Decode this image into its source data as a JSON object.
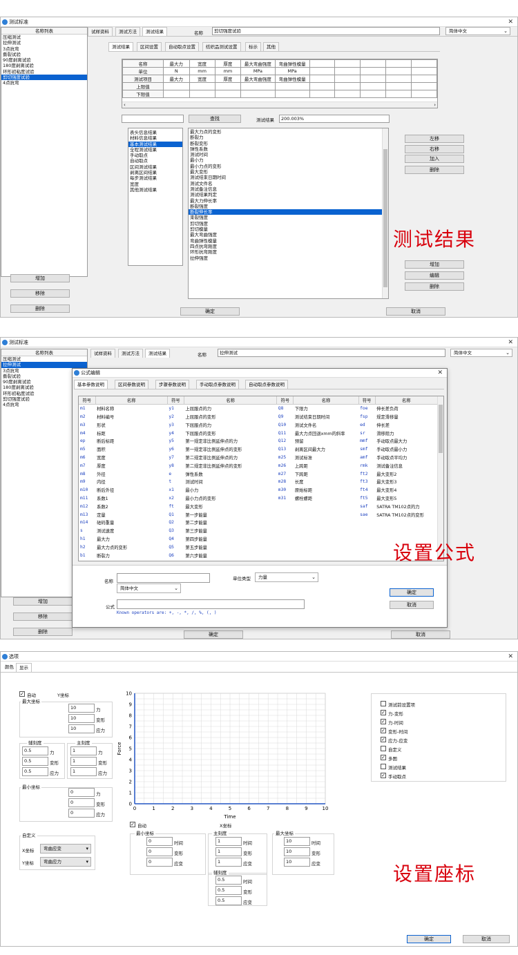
{
  "s1": {
    "title": "测试标准",
    "tabs": [
      "试样资料",
      "测试方法",
      "测试结果"
    ],
    "name_label": "名称",
    "name_value": "剪切强度试验",
    "lang": "简体中文",
    "std_header": "名称列表",
    "standards": [
      "压缩测试",
      "拉伸测试",
      "3点抗弯",
      "撕裂试验",
      "90度剥离试验",
      "180度剥离试验",
      "环形初粘度试验",
      "剪切强度试验",
      "4点抗弯"
    ],
    "std_selected": 7,
    "left_buttons": [
      "增加",
      "移除",
      "删除"
    ],
    "subtabs": [
      "测试结果",
      "区间设置",
      "自动取点设置",
      "纺织品测试设置",
      "标示",
      "其他"
    ],
    "grid_rows": [
      [
        "名称",
        "最大力",
        "宽度",
        "厚度",
        "最大弯曲强度",
        "弯曲弹性模量"
      ],
      [
        "单位",
        "N",
        "mm",
        "mm",
        "MPa",
        "MPa"
      ],
      [
        "测试项目",
        "最大力",
        "宽度",
        "厚度",
        "最大弯曲强度",
        "弯曲弹性模量"
      ],
      [
        "上限值",
        "",
        "",
        "",
        "",
        ""
      ],
      [
        "下限值",
        "",
        "",
        "",
        "",
        ""
      ]
    ],
    "search_btn": "查找",
    "result_label": "测试结果",
    "result_value": "200.003%",
    "categories": [
      "表头信息结果",
      "材料信息结果",
      "基本测试结果",
      "全程测试结果",
      "手动取点",
      "自动取点",
      "区间测试结果",
      "剥离区间结果",
      "每步测试结果",
      "宽度",
      "其他测试结果"
    ],
    "cat_selected": 2,
    "items": [
      "最大力点的变形",
      "断裂力",
      "断裂变形",
      "弹性系数",
      "测试时间",
      "最小力",
      "最小力点的变形",
      "最大变形",
      "测试结束日期时间",
      "测试文件名",
      "测试备注信息",
      "测试结果判定",
      "最大力伸长率",
      "断裂强度",
      "断裂伸长率",
      "束裂强度",
      "剪切强度",
      "剪切模量",
      "最大弯曲强度",
      "弯曲弹性模量",
      "四点抗弯刚度",
      "环形抗弯刚度",
      "拉伸强度"
    ],
    "item_selected": 14,
    "right_buttons_top": [
      "左移",
      "右移",
      "加入",
      "删除"
    ],
    "right_buttons_bot": [
      "增加",
      "编辑",
      "删除"
    ],
    "ok": "确定",
    "cancel": "取消",
    "caption": "测试结果"
  },
  "s2": {
    "title": "测试标准",
    "tabs": [
      "试样资料",
      "测试方法",
      "测试结果"
    ],
    "name_label": "名称",
    "name_value": "拉伸测试",
    "lang": "简体中文",
    "std_header": "名称列表",
    "standards": [
      "压缩测试",
      "拉伸测试",
      "3点抗弯",
      "撕裂试验",
      "90度剥离试验",
      "180度剥离试验",
      "环形初粘度试验",
      "剪切强度试验",
      "4点抗弯"
    ],
    "std_selected": 1,
    "left_buttons": [
      "增加",
      "移除",
      "删除"
    ],
    "ok": "确定",
    "cancel": "取消",
    "dialog": {
      "title": "公式编辑",
      "tabs": [
        "基本参数说明",
        "区间参数说明",
        "步骤参数说明",
        "手动取点参数说明",
        "自动取点参数说明"
      ],
      "headers": [
        "符号",
        "名称",
        "符号",
        "名称",
        "符号",
        "名称",
        "符号",
        "名称"
      ],
      "rows": [
        [
          "m1",
          "材料名称",
          "y1",
          "上屈服点的力",
          "Q8",
          "下限力",
          "foe",
          "伸长差负荷"
        ],
        [
          "m2",
          "材料编号",
          "y2",
          "上屈服点的变形",
          "Q9",
          "测试结束日期时间",
          "fsp",
          "规定滑移量"
        ],
        [
          "m3",
          "形状",
          "y3",
          "下屈服点的力",
          "Q10",
          "测试文件名",
          "ed",
          "伸长差"
        ],
        [
          "m4",
          "标距",
          "y4",
          "下屈服点的变形",
          "Q11",
          "最大力点回退xmm的斜率",
          "sr",
          "滑移阻力"
        ],
        [
          "ep",
          "断后标距",
          "y5",
          "第一规定非比例延伸点的力",
          "Q12",
          "预留",
          "mmf",
          "手动取点最大力"
        ],
        [
          "m5",
          "面积",
          "y6",
          "第一规定非比例延伸点的变形",
          "Q13",
          "剥离区间最大力",
          "smf",
          "手动取点最小力"
        ],
        [
          "m6",
          "宽度",
          "y7",
          "第二规定非比例延伸点的力",
          "m25",
          "测试标准",
          "amf",
          "手动取点平均力"
        ],
        [
          "m7",
          "厚度",
          "y8",
          "第二规定非比例延伸点的变形",
          "m26",
          "上跨距",
          "rmk",
          "测试备注信息"
        ],
        [
          "m8",
          "外径",
          "e",
          "弹性系数",
          "m27",
          "下跨距",
          "ft2",
          "最大变形2"
        ],
        [
          "m9",
          "内径",
          "t",
          "测试时间",
          "m28",
          "长度",
          "ft3",
          "最大变形3"
        ],
        [
          "m10",
          "断后外径",
          "x1",
          "最小力",
          "m30",
          "原始标距",
          "ft4",
          "最大变形4"
        ],
        [
          "m11",
          "系数1",
          "x2",
          "最小力点的变形",
          "m31",
          "螺栓螺距",
          "ft5",
          "最大变形5"
        ],
        [
          "m12",
          "系数2",
          "ft",
          "最大变形",
          "",
          "",
          "saf",
          "SATRA TM102点的力"
        ],
        [
          "m13",
          "定量",
          "Q1",
          "第一步能量",
          "",
          "",
          "sae",
          "SATRA TM102点的变形"
        ],
        [
          "m14",
          "砝码重量",
          "Q2",
          "第二步能量",
          "",
          "",
          "",
          ""
        ],
        [
          "s",
          "测试速度",
          "Q3",
          "第三步能量",
          "",
          "",
          "",
          ""
        ],
        [
          "h1",
          "最大力",
          "Q4",
          "第四步能量",
          "",
          "",
          "",
          ""
        ],
        [
          "h2",
          "最大力点的变形",
          "Q5",
          "第五步能量",
          "",
          "",
          "",
          ""
        ],
        [
          "b1",
          "断裂力",
          "Q6",
          "第六步能量",
          "",
          "",
          "",
          ""
        ]
      ],
      "name_label": "名称",
      "lang_value": "简体中文",
      "unit_label": "单位类型",
      "unit_value": "力量",
      "formula_label": "公式",
      "operators": "Known operators are: +, -, *, /, %, (, )",
      "ok": "确定",
      "cancel": "取消"
    },
    "caption": "设置公式"
  },
  "s3": {
    "title": "选项",
    "tabs": [
      "颜色",
      "显示"
    ],
    "auto_label": "自动",
    "y_axis_label": "Y坐标",
    "max_label": "最大坐标",
    "max_vals": [
      [
        "10",
        "力"
      ],
      [
        "10",
        "变形"
      ],
      [
        "10",
        "应力"
      ]
    ],
    "aux_label": "辅刻度",
    "aux_vals": [
      [
        "0.5",
        "力"
      ],
      [
        "0.5",
        "变形"
      ],
      [
        "0.5",
        "应力"
      ]
    ],
    "main_label": "主刻度",
    "main_vals": [
      [
        "1",
        "力"
      ],
      [
        "1",
        "变形"
      ],
      [
        "1",
        "应力"
      ]
    ],
    "min_label": "最小坐标",
    "min_vals": [
      [
        "0",
        "力"
      ],
      [
        "0",
        "变形"
      ],
      [
        "0",
        "应力"
      ]
    ],
    "custom_label": "自定义",
    "x_label": "X坐标",
    "x_value": "弯曲应变",
    "y_label": "Y坐标",
    "y_value": "弯曲应力",
    "chart": {
      "xlabel": "Time",
      "ylabel": "Force",
      "x_ticks": [
        "0",
        "1",
        "2",
        "3",
        "4",
        "5",
        "6",
        "7",
        "8",
        "9",
        "10"
      ],
      "y_ticks": [
        "0",
        "1",
        "2",
        "3",
        "4",
        "5",
        "6",
        "7",
        "8",
        "9",
        "10"
      ],
      "grid_color": "#d9d9d9",
      "axis_color": "#2255c4"
    },
    "x_auto_label": "自动",
    "x_axis_label": "X坐标",
    "x_min_label": "最小坐标",
    "x_min_vals": [
      [
        "0",
        "时间"
      ],
      [
        "0",
        "变形"
      ],
      [
        "0",
        "应变"
      ]
    ],
    "x_main_label": "主刻度",
    "x_main_vals": [
      [
        "1",
        "时间"
      ],
      [
        "1",
        "变形"
      ],
      [
        "1",
        "应变"
      ]
    ],
    "x_max_label": "最大坐标",
    "x_max_vals": [
      [
        "10",
        "时间"
      ],
      [
        "10",
        "变形"
      ],
      [
        "10",
        "应变"
      ]
    ],
    "x_aux_label": "辅刻度",
    "x_aux_vals": [
      [
        "0.5",
        "时间"
      ],
      [
        "0.5",
        "变形"
      ],
      [
        "0.5",
        "应变"
      ]
    ],
    "options": [
      {
        "label": "测试前设置项",
        "checked": false
      },
      {
        "label": "力-变形",
        "checked": true
      },
      {
        "label": "力-时间",
        "checked": true
      },
      {
        "label": "变形-时间",
        "checked": true
      },
      {
        "label": "应力-应变",
        "checked": true
      },
      {
        "label": "自定义",
        "checked": false
      },
      {
        "label": "多图",
        "checked": true
      },
      {
        "label": "测试结果",
        "checked": false
      },
      {
        "label": "手动取点",
        "checked": true
      }
    ],
    "ok": "确定",
    "cancel": "取消",
    "caption": "设置座标"
  },
  "colors": {
    "accent": "#0a62d0",
    "caption": "#d8000c"
  }
}
